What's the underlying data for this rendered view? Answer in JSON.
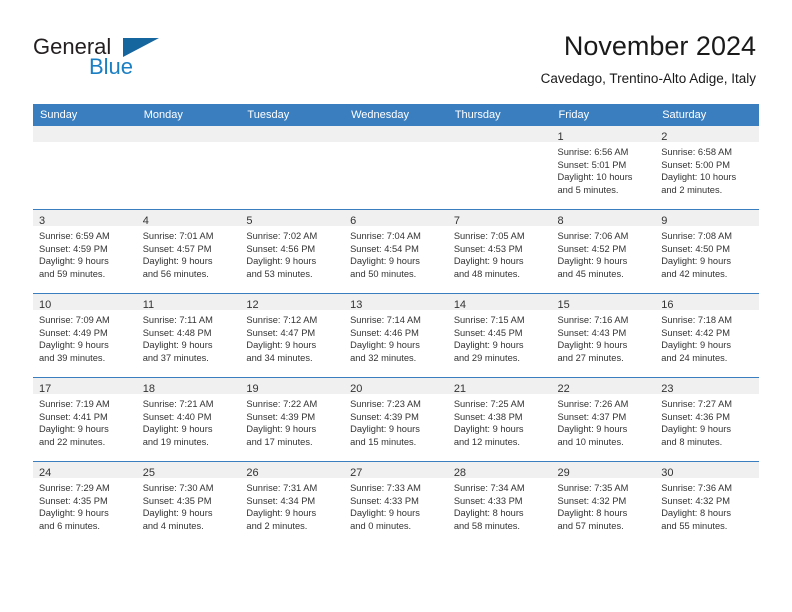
{
  "brand": {
    "name_part1": "General",
    "name_part2": "Blue",
    "accent_color": "#1b7fc4",
    "triangle_color": "#15659f"
  },
  "header": {
    "title": "November 2024",
    "subtitle": "Cavedago, Trentino-Alto Adige, Italy"
  },
  "theme": {
    "header_row_bg": "#3a7ebf",
    "daynum_band_bg": "#f0f0f0",
    "grid_line": "#3a7ebf",
    "text": "#333333"
  },
  "weekdays": [
    "Sunday",
    "Monday",
    "Tuesday",
    "Wednesday",
    "Thursday",
    "Friday",
    "Saturday"
  ],
  "weeks": [
    [
      {
        "blank": true
      },
      {
        "blank": true
      },
      {
        "blank": true
      },
      {
        "blank": true
      },
      {
        "blank": true
      },
      {
        "day": "1",
        "sunrise": "Sunrise: 6:56 AM",
        "sunset": "Sunset: 5:01 PM",
        "daylight1": "Daylight: 10 hours",
        "daylight2": "and 5 minutes."
      },
      {
        "day": "2",
        "sunrise": "Sunrise: 6:58 AM",
        "sunset": "Sunset: 5:00 PM",
        "daylight1": "Daylight: 10 hours",
        "daylight2": "and 2 minutes."
      }
    ],
    [
      {
        "day": "3",
        "sunrise": "Sunrise: 6:59 AM",
        "sunset": "Sunset: 4:59 PM",
        "daylight1": "Daylight: 9 hours",
        "daylight2": "and 59 minutes."
      },
      {
        "day": "4",
        "sunrise": "Sunrise: 7:01 AM",
        "sunset": "Sunset: 4:57 PM",
        "daylight1": "Daylight: 9 hours",
        "daylight2": "and 56 minutes."
      },
      {
        "day": "5",
        "sunrise": "Sunrise: 7:02 AM",
        "sunset": "Sunset: 4:56 PM",
        "daylight1": "Daylight: 9 hours",
        "daylight2": "and 53 minutes."
      },
      {
        "day": "6",
        "sunrise": "Sunrise: 7:04 AM",
        "sunset": "Sunset: 4:54 PM",
        "daylight1": "Daylight: 9 hours",
        "daylight2": "and 50 minutes."
      },
      {
        "day": "7",
        "sunrise": "Sunrise: 7:05 AM",
        "sunset": "Sunset: 4:53 PM",
        "daylight1": "Daylight: 9 hours",
        "daylight2": "and 48 minutes."
      },
      {
        "day": "8",
        "sunrise": "Sunrise: 7:06 AM",
        "sunset": "Sunset: 4:52 PM",
        "daylight1": "Daylight: 9 hours",
        "daylight2": "and 45 minutes."
      },
      {
        "day": "9",
        "sunrise": "Sunrise: 7:08 AM",
        "sunset": "Sunset: 4:50 PM",
        "daylight1": "Daylight: 9 hours",
        "daylight2": "and 42 minutes."
      }
    ],
    [
      {
        "day": "10",
        "sunrise": "Sunrise: 7:09 AM",
        "sunset": "Sunset: 4:49 PM",
        "daylight1": "Daylight: 9 hours",
        "daylight2": "and 39 minutes."
      },
      {
        "day": "11",
        "sunrise": "Sunrise: 7:11 AM",
        "sunset": "Sunset: 4:48 PM",
        "daylight1": "Daylight: 9 hours",
        "daylight2": "and 37 minutes."
      },
      {
        "day": "12",
        "sunrise": "Sunrise: 7:12 AM",
        "sunset": "Sunset: 4:47 PM",
        "daylight1": "Daylight: 9 hours",
        "daylight2": "and 34 minutes."
      },
      {
        "day": "13",
        "sunrise": "Sunrise: 7:14 AM",
        "sunset": "Sunset: 4:46 PM",
        "daylight1": "Daylight: 9 hours",
        "daylight2": "and 32 minutes."
      },
      {
        "day": "14",
        "sunrise": "Sunrise: 7:15 AM",
        "sunset": "Sunset: 4:45 PM",
        "daylight1": "Daylight: 9 hours",
        "daylight2": "and 29 minutes."
      },
      {
        "day": "15",
        "sunrise": "Sunrise: 7:16 AM",
        "sunset": "Sunset: 4:43 PM",
        "daylight1": "Daylight: 9 hours",
        "daylight2": "and 27 minutes."
      },
      {
        "day": "16",
        "sunrise": "Sunrise: 7:18 AM",
        "sunset": "Sunset: 4:42 PM",
        "daylight1": "Daylight: 9 hours",
        "daylight2": "and 24 minutes."
      }
    ],
    [
      {
        "day": "17",
        "sunrise": "Sunrise: 7:19 AM",
        "sunset": "Sunset: 4:41 PM",
        "daylight1": "Daylight: 9 hours",
        "daylight2": "and 22 minutes."
      },
      {
        "day": "18",
        "sunrise": "Sunrise: 7:21 AM",
        "sunset": "Sunset: 4:40 PM",
        "daylight1": "Daylight: 9 hours",
        "daylight2": "and 19 minutes."
      },
      {
        "day": "19",
        "sunrise": "Sunrise: 7:22 AM",
        "sunset": "Sunset: 4:39 PM",
        "daylight1": "Daylight: 9 hours",
        "daylight2": "and 17 minutes."
      },
      {
        "day": "20",
        "sunrise": "Sunrise: 7:23 AM",
        "sunset": "Sunset: 4:39 PM",
        "daylight1": "Daylight: 9 hours",
        "daylight2": "and 15 minutes."
      },
      {
        "day": "21",
        "sunrise": "Sunrise: 7:25 AM",
        "sunset": "Sunset: 4:38 PM",
        "daylight1": "Daylight: 9 hours",
        "daylight2": "and 12 minutes."
      },
      {
        "day": "22",
        "sunrise": "Sunrise: 7:26 AM",
        "sunset": "Sunset: 4:37 PM",
        "daylight1": "Daylight: 9 hours",
        "daylight2": "and 10 minutes."
      },
      {
        "day": "23",
        "sunrise": "Sunrise: 7:27 AM",
        "sunset": "Sunset: 4:36 PM",
        "daylight1": "Daylight: 9 hours",
        "daylight2": "and 8 minutes."
      }
    ],
    [
      {
        "day": "24",
        "sunrise": "Sunrise: 7:29 AM",
        "sunset": "Sunset: 4:35 PM",
        "daylight1": "Daylight: 9 hours",
        "daylight2": "and 6 minutes."
      },
      {
        "day": "25",
        "sunrise": "Sunrise: 7:30 AM",
        "sunset": "Sunset: 4:35 PM",
        "daylight1": "Daylight: 9 hours",
        "daylight2": "and 4 minutes."
      },
      {
        "day": "26",
        "sunrise": "Sunrise: 7:31 AM",
        "sunset": "Sunset: 4:34 PM",
        "daylight1": "Daylight: 9 hours",
        "daylight2": "and 2 minutes."
      },
      {
        "day": "27",
        "sunrise": "Sunrise: 7:33 AM",
        "sunset": "Sunset: 4:33 PM",
        "daylight1": "Daylight: 9 hours",
        "daylight2": "and 0 minutes."
      },
      {
        "day": "28",
        "sunrise": "Sunrise: 7:34 AM",
        "sunset": "Sunset: 4:33 PM",
        "daylight1": "Daylight: 8 hours",
        "daylight2": "and 58 minutes."
      },
      {
        "day": "29",
        "sunrise": "Sunrise: 7:35 AM",
        "sunset": "Sunset: 4:32 PM",
        "daylight1": "Daylight: 8 hours",
        "daylight2": "and 57 minutes."
      },
      {
        "day": "30",
        "sunrise": "Sunrise: 7:36 AM",
        "sunset": "Sunset: 4:32 PM",
        "daylight1": "Daylight: 8 hours",
        "daylight2": "and 55 minutes."
      }
    ]
  ]
}
